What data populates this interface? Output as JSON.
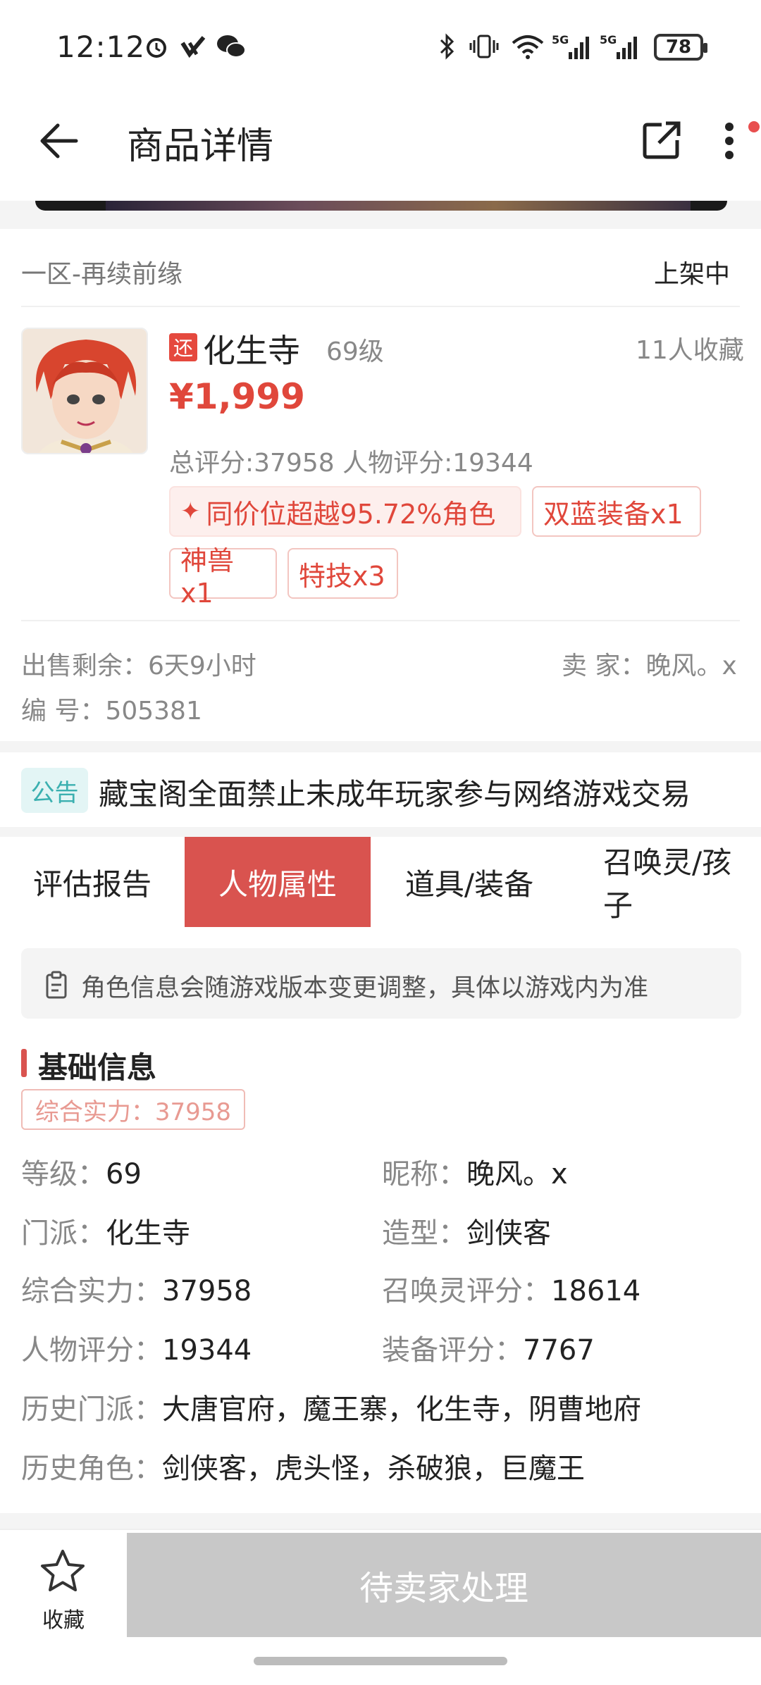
{
  "status_bar": {
    "time": "12:12",
    "battery": "78",
    "net1": "5G",
    "net2": "5G"
  },
  "header": {
    "title": "商品详情"
  },
  "listing": {
    "server": "一区-再续前缘",
    "state": "上架中",
    "tag": "还",
    "school": "化生寺",
    "level": "69级",
    "favorites": "11人收藏",
    "price": "¥1,999",
    "scores": "总评分:37958   人物评分:19344",
    "main_tag": "同价位超越95.72%角色",
    "tags": [
      "双蓝装备x1",
      "神兽x1",
      "特技x3"
    ],
    "remain": "出售剩余：6天9小时",
    "seller": "卖  家：晚风。x",
    "serial": "编  号：505381"
  },
  "notice": {
    "tag": "公告",
    "text": "藏宝阁全面禁止未成年玩家参与网络游戏交易"
  },
  "tabs": [
    "评估报告",
    "人物属性",
    "道具/装备",
    "召唤灵/孩子"
  ],
  "attributes": {
    "hint": "角色信息会随游戏版本变更调整，具体以游戏内为准",
    "section_title": "基础信息",
    "power_tag": "综合实力：37958",
    "rows": [
      {
        "k": "等级：",
        "v": "69"
      },
      {
        "k": "昵称：",
        "v": "晚风。x"
      },
      {
        "k": "门派：",
        "v": "化生寺"
      },
      {
        "k": "造型：",
        "v": "剑侠客"
      },
      {
        "k": "综合实力：",
        "v": "37958"
      },
      {
        "k": "召唤灵评分：",
        "v": "18614"
      },
      {
        "k": "人物评分：",
        "v": "19344"
      },
      {
        "k": "装备评分：",
        "v": "7767"
      },
      {
        "k": "历史门派：",
        "v": "大唐官府，魔王寨，化生寺，阴曹地府"
      },
      {
        "k": "历史角色：",
        "v": "剑侠客，虎头怪，杀破狼，巨魔王"
      }
    ]
  },
  "bottom": {
    "favorite_label": "收藏",
    "pending_label": "待卖家处理"
  },
  "colors": {
    "accent": "#d9534f",
    "price": "#e0473b",
    "notice": "#3bb0b0"
  }
}
